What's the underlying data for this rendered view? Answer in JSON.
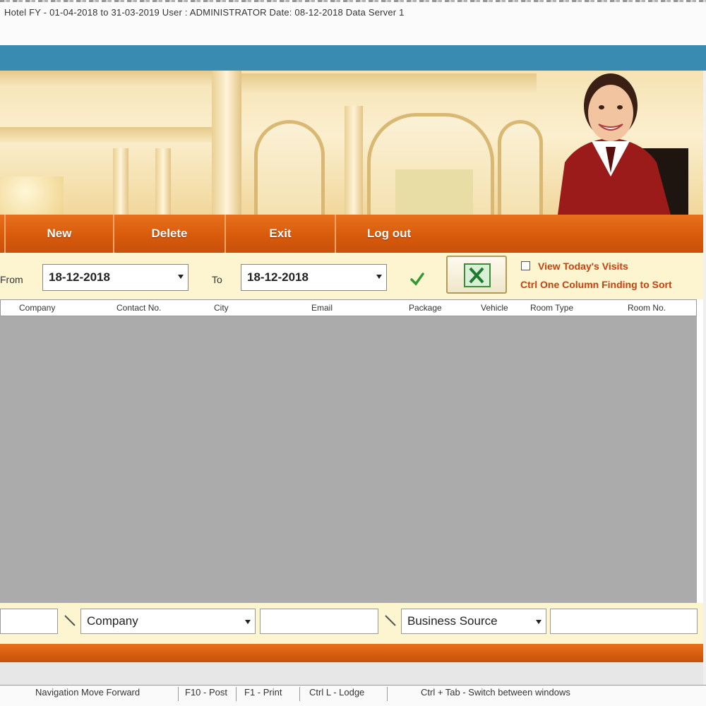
{
  "window": {
    "title": "Hotel FY - 01-04-2018 to 31-03-2019 User : ADMINISTRATOR Date: 08-12-2018 Data Server 1"
  },
  "nav": {
    "items": [
      {
        "label": "New"
      },
      {
        "label": "Delete"
      },
      {
        "label": "Exit"
      },
      {
        "label": "Log out"
      }
    ]
  },
  "filter": {
    "from_label": "From",
    "from_date": "18-12-2018",
    "to_label": "To",
    "to_date": "18-12-2018",
    "checkbox_label": "View Today's Visits",
    "note": "Ctrl One Column Finding to Sort"
  },
  "grid": {
    "columns": [
      "Company",
      "Contact No.",
      "City",
      "Email",
      "Package",
      "Vehicle",
      "Room Type",
      "Room No."
    ]
  },
  "search": {
    "field1_value": "",
    "combo1": "Company",
    "field2_value": "",
    "combo2": "Business Source",
    "field3_value": ""
  },
  "status": {
    "items": [
      "Navigation Move Forward",
      "F10 - Post",
      "F1 - Print",
      "Ctrl L - Lodge",
      "Ctrl + Tab - Switch between windows"
    ]
  },
  "colors": {
    "accent_orange": "#d85b0c",
    "title_blue": "#3a8bb2",
    "panel_cream": "#fcf5cf",
    "grid_grey": "#ababab",
    "note_red": "#c8400f"
  }
}
